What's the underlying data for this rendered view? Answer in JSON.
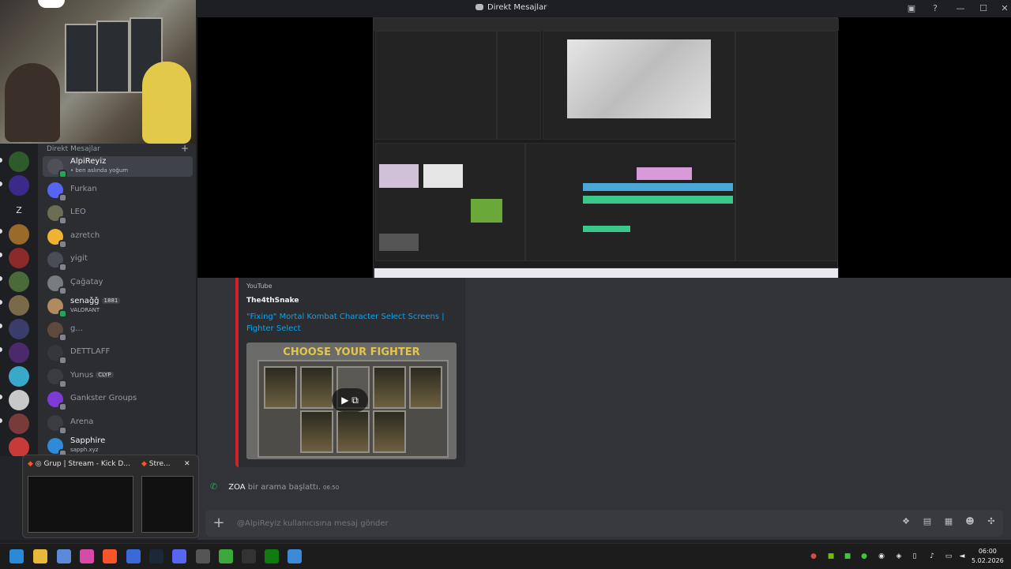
{
  "window": {
    "title": "Direkt Mesajlar"
  },
  "dm": {
    "header": "Direkt Mesajlar",
    "items": [
      {
        "name": "AlpiReyiz",
        "sub": "• ben aslında yoğum",
        "active": true,
        "status": "#23a55a",
        "avatar": "#4e5058"
      },
      {
        "name": "Furkan",
        "sub": "",
        "status": "#80848e",
        "avatar": "#5865f2"
      },
      {
        "name": "LEO",
        "sub": "",
        "status": "#80848e",
        "avatar": "#6b6e55"
      },
      {
        "name": "azretch",
        "sub": "",
        "status": "#80848e",
        "avatar": "#f0b232"
      },
      {
        "name": "yigit",
        "sub": "",
        "status": "#80848e",
        "avatar": "#4a4d55"
      },
      {
        "name": "Çağatay",
        "sub": "",
        "status": "#80848e",
        "avatar": "#787b82"
      },
      {
        "name": "senaǧǧ",
        "badge": "1881",
        "sub": "VALORANT",
        "status": "#23a55a",
        "avatar": "#b08a60"
      },
      {
        "name": "g...",
        "sub": "",
        "status": "#80848e",
        "avatar": "#5e4a3c"
      },
      {
        "name": "DETTLAFF",
        "sub": "",
        "status": "#80848e",
        "avatar": "#35373c"
      },
      {
        "name": "Yunus",
        "badge": "CLYP",
        "sub": "",
        "status": "#80848e",
        "avatar": "#3a3c42"
      },
      {
        "name": "Gankster Groups",
        "sub": "",
        "status": "#80848e",
        "avatar": "#7e3ad6"
      },
      {
        "name": "Arena",
        "sub": "",
        "status": "#80848e",
        "avatar": "#3a3c42"
      },
      {
        "name": "Sapphire",
        "sub": "sapph.xyz",
        "status": "#80848e",
        "avatar": "#2f8ad8"
      }
    ]
  },
  "embed": {
    "provider": "YouTube",
    "author": "The4thSnake",
    "title": "\"Fixing\" Mortal Kombat Character Select Screens | Fighter Select",
    "thumb_title": "CHOOSE YOUR FIGHTER"
  },
  "call": {
    "who": "ZOA",
    "text": "bir arama başlattı.",
    "time": "06:50"
  },
  "composer": {
    "placeholder": "@AlpiReyiz kullanıcısına mesaj gönder"
  },
  "popup": {
    "tab1": "Grup | Stream - Kick D...",
    "tab2": "Stre...",
    "close": "✕"
  },
  "servers": {
    "z_label": "Z"
  },
  "clock": {
    "time": "06:00",
    "date": "5.02.2026"
  },
  "icons": {
    "plus": "+",
    "window_close": "✕",
    "window_max": "☐",
    "window_min": "—"
  }
}
